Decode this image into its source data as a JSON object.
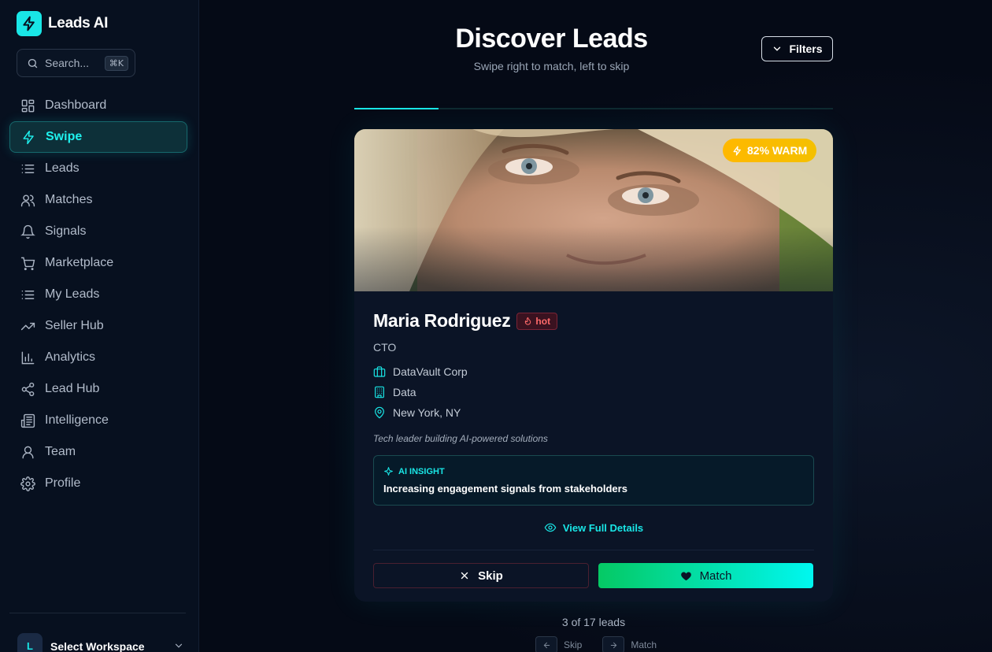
{
  "brand": {
    "name": "Leads AI"
  },
  "search": {
    "label": "Search...",
    "shortcut": "⌘K"
  },
  "sidebar": {
    "items": [
      {
        "label": "Dashboard",
        "icon": "grid-icon"
      },
      {
        "label": "Swipe",
        "icon": "bolt-icon",
        "active": true
      },
      {
        "label": "Leads",
        "icon": "list-icon"
      },
      {
        "label": "Matches",
        "icon": "users-icon"
      },
      {
        "label": "Signals",
        "icon": "bell-icon"
      },
      {
        "label": "Marketplace",
        "icon": "cart-icon"
      },
      {
        "label": "My Leads",
        "icon": "list-icon"
      },
      {
        "label": "Seller Hub",
        "icon": "trending-up-icon"
      },
      {
        "label": "Analytics",
        "icon": "bar-chart-icon"
      },
      {
        "label": "Lead Hub",
        "icon": "share-icon"
      },
      {
        "label": "Intelligence",
        "icon": "newspaper-icon"
      },
      {
        "label": "Team",
        "icon": "user-icon"
      },
      {
        "label": "Profile",
        "icon": "gear-icon"
      }
    ],
    "workspace": {
      "avatar": "L",
      "label": "Select Workspace"
    }
  },
  "header": {
    "title": "Discover Leads",
    "subtitle": "Swipe right to match, left to skip",
    "filters_label": "Filters"
  },
  "progress": {
    "fraction": 0.176
  },
  "card": {
    "score_label": "82% WARM",
    "name": "Maria Rodriguez",
    "temperature": "hot",
    "title": "CTO",
    "company": "DataVault Corp",
    "industry": "Data",
    "location": "New York, NY",
    "tagline": "Tech leader building AI-powered solutions",
    "insight_heading": "AI INSIGHT",
    "insight_text": "Increasing engagement signals from stakeholders",
    "view_details_label": "View Full Details",
    "skip_label": "Skip",
    "match_label": "Match"
  },
  "footer": {
    "count_label": "3 of 17 leads",
    "hint_skip": "Skip",
    "hint_match": "Match"
  },
  "colors": {
    "accent": "#19e6e6",
    "warm": "#ffb800",
    "hot": "#ff6a6a",
    "match_start": "#05c964",
    "match_end": "#00f7f0"
  }
}
